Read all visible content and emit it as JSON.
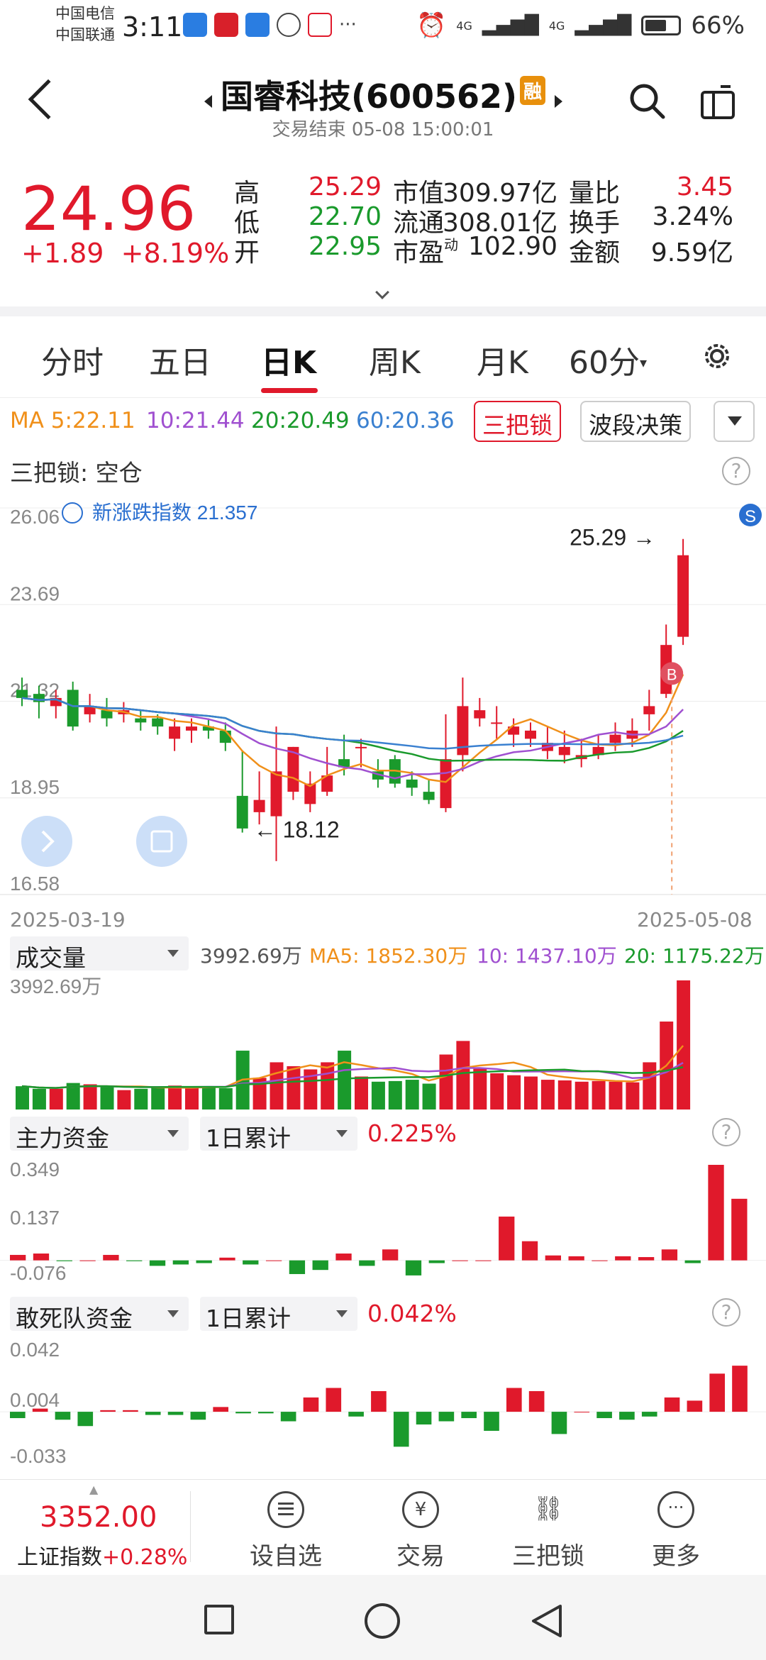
{
  "status_bar": {
    "carrier1": "中国电信",
    "carrier2": "中国联通",
    "time": "3:11",
    "battery": "66%",
    "battery_level": 0.66,
    "net1": "4G",
    "net2": "4G"
  },
  "header": {
    "title": "国睿科技(600562)",
    "badge": "融",
    "subtitle": "交易结束 05-08 15:00:01"
  },
  "quote": {
    "price": "24.96",
    "change": "+1.89",
    "change_pct": "+8.19%",
    "stats": [
      {
        "label": "高",
        "value": "25.29",
        "color": "#e0192b"
      },
      {
        "label": "低",
        "value": "22.70",
        "color": "#1a9a2c"
      },
      {
        "label": "开",
        "value": "22.95",
        "color": "#1a9a2c"
      }
    ],
    "stats2": [
      {
        "label": "市值",
        "value": "309.97亿"
      },
      {
        "label": "流通",
        "value": "308.01亿"
      },
      {
        "label": "市盈",
        "sup": "动",
        "value": "102.90"
      }
    ],
    "stats3": [
      {
        "label": "量比",
        "value": "3.45",
        "color": "#e0192b"
      },
      {
        "label": "换手",
        "value": "3.24%",
        "color": "#222"
      },
      {
        "label": "金额",
        "value": "9.59亿",
        "color": "#222"
      }
    ]
  },
  "tabs": [
    "分时",
    "五日",
    "日K",
    "周K",
    "月K",
    "60分"
  ],
  "active_tab": "日K",
  "ma": {
    "ma5": "MA 5:22.11",
    "ma10": "10:21.44",
    "ma20": "20:20.49",
    "ma60": "60:20.36",
    "btn_lock": "三把锁",
    "btn_wave": "波段决策"
  },
  "lock_status": "三把锁: 空仓",
  "kline": {
    "index_label": "新涨跌指数 21.357",
    "y_ticks": [
      "26.06",
      "23.69",
      "21.32",
      "18.95",
      "16.58"
    ],
    "high_label": "25.29",
    "low_label": "18.12",
    "date_start": "2025-03-19",
    "date_end": "2025-05-08",
    "s_badge": "S",
    "b_badge": "B"
  },
  "volume": {
    "selector": "成交量",
    "total": "3992.69万",
    "ma5": "MA5: 1852.30万",
    "ma10": "10: 1437.10万",
    "ma20": "20: 1175.22万",
    "top_tick": "3992.69万"
  },
  "main_fund": {
    "selector": "主力资金",
    "period": "1日累计",
    "value": "0.225%",
    "ticks": [
      "0.349",
      "0.137",
      "-0.076"
    ]
  },
  "dare_fund": {
    "selector": "敢死队资金",
    "period": "1日累计",
    "value": "0.042%",
    "ticks": [
      "0.042",
      "0.004",
      "-0.033"
    ]
  },
  "bottom": {
    "index_value": "3352.00",
    "index_name": "上证指数",
    "index_change": "+0.28%",
    "items": [
      "设自选",
      "交易",
      "三把锁",
      "更多"
    ]
  },
  "chart_data": [
    {
      "type": "candlestick",
      "title": "",
      "ylim": [
        16.58,
        26.06
      ],
      "x": [
        "2025-03-19",
        "2025-05-08"
      ],
      "series": [
        {
          "name": "K",
          "values": [
            [
              21.6,
              21.4,
              21.9,
              21.2
            ],
            [
              21.5,
              21.3,
              21.7,
              20.9
            ],
            [
              21.2,
              21.4,
              21.6,
              20.9
            ],
            [
              21.6,
              20.7,
              21.8,
              20.6
            ],
            [
              21.0,
              21.2,
              21.5,
              20.8
            ],
            [
              21.1,
              20.9,
              21.4,
              20.7
            ],
            [
              21.0,
              21.1,
              21.3,
              20.8
            ],
            [
              20.9,
              20.8,
              21.1,
              20.6
            ],
            [
              20.9,
              20.7,
              21.0,
              20.5
            ],
            [
              20.4,
              20.7,
              20.9,
              20.1
            ],
            [
              20.6,
              20.7,
              20.9,
              20.3
            ],
            [
              20.7,
              20.6,
              20.9,
              20.4
            ],
            [
              20.6,
              20.3,
              20.8,
              20.1
            ],
            [
              19.0,
              18.2,
              20.1,
              18.1
            ],
            [
              18.6,
              18.9,
              19.6,
              18.3
            ],
            [
              18.5,
              19.6,
              20.7,
              17.4
            ],
            [
              19.1,
              20.2,
              20.2,
              18.9
            ],
            [
              18.8,
              19.3,
              19.6,
              18.6
            ],
            [
              19.1,
              19.5,
              20.2,
              19.0
            ],
            [
              19.9,
              19.7,
              20.5,
              19.5
            ],
            [
              20.2,
              20.2,
              20.4,
              19.7
            ],
            [
              19.6,
              19.4,
              19.9,
              19.2
            ],
            [
              19.9,
              19.3,
              20.0,
              19.2
            ],
            [
              19.4,
              19.2,
              19.6,
              19.0
            ],
            [
              19.1,
              18.9,
              19.4,
              18.8
            ],
            [
              18.7,
              19.9,
              21.0,
              18.6
            ],
            [
              20.0,
              21.2,
              21.9,
              19.6
            ],
            [
              20.9,
              21.1,
              21.4,
              20.7
            ],
            [
              20.8,
              20.8,
              21.2,
              20.4
            ],
            [
              20.5,
              20.7,
              20.9,
              20.2
            ],
            [
              20.4,
              20.6,
              20.8,
              20.2
            ],
            [
              20.1,
              20.3,
              20.7,
              19.9
            ],
            [
              20.0,
              20.2,
              20.6,
              19.8
            ],
            [
              19.9,
              20.0,
              20.4,
              19.7
            ],
            [
              20.0,
              20.2,
              20.5,
              19.9
            ],
            [
              20.3,
              20.5,
              20.8,
              20.1
            ],
            [
              20.4,
              20.6,
              20.9,
              20.2
            ],
            [
              21.0,
              21.2,
              21.6,
              20.6
            ],
            [
              21.5,
              22.7,
              23.2,
              21.4
            ],
            [
              22.9,
              24.9,
              25.3,
              22.7
            ]
          ]
        },
        {
          "name": "MA 5",
          "color": "#f0901a"
        },
        {
          "name": "10",
          "color": "#a050d0"
        },
        {
          "name": "20",
          "color": "#1a9a2c"
        },
        {
          "name": "60",
          "color": "#3a80d0"
        }
      ]
    },
    {
      "type": "bar",
      "title": "成交量",
      "values": [
        720,
        640,
        640,
        820,
        780,
        720,
        600,
        640,
        680,
        740,
        700,
        700,
        660,
        1820,
        980,
        1460,
        1340,
        1240,
        1460,
        1820,
        1020,
        860,
        880,
        920,
        800,
        1700,
        2120,
        1260,
        1120,
        1060,
        1020,
        920,
        900,
        860,
        880,
        860,
        840,
        1460,
        2720,
        3992.69
      ]
    },
    {
      "type": "bar",
      "title": "主力资金",
      "ylim": [
        -0.076,
        0.349
      ],
      "values": [
        0.02,
        0.025,
        -0.003,
        0,
        0.02,
        -0.003,
        -0.02,
        -0.015,
        -0.01,
        0.01,
        -0.015,
        0,
        -0.05,
        -0.035,
        0.025,
        -0.02,
        0.04,
        -0.055,
        -0.01,
        0,
        0,
        0.16,
        0.07,
        0.018,
        0.015,
        0,
        0.015,
        0.012,
        0.04,
        -0.01,
        0.349,
        0.225
      ]
    },
    {
      "type": "bar",
      "title": "敢死队资金",
      "ylim": [
        -0.033,
        0.042
      ],
      "values": [
        -0.004,
        0.002,
        -0.005,
        -0.009,
        0.001,
        0.001,
        -0.002,
        -0.002,
        -0.005,
        0.003,
        -0.001,
        -0.001,
        -0.006,
        0.009,
        0.015,
        -0.003,
        0.013,
        -0.022,
        -0.008,
        -0.006,
        -0.004,
        -0.012,
        0.015,
        0.013,
        -0.014,
        0,
        -0.004,
        -0.005,
        -0.003,
        0.009,
        0.007,
        0.024,
        0.029
      ]
    }
  ]
}
